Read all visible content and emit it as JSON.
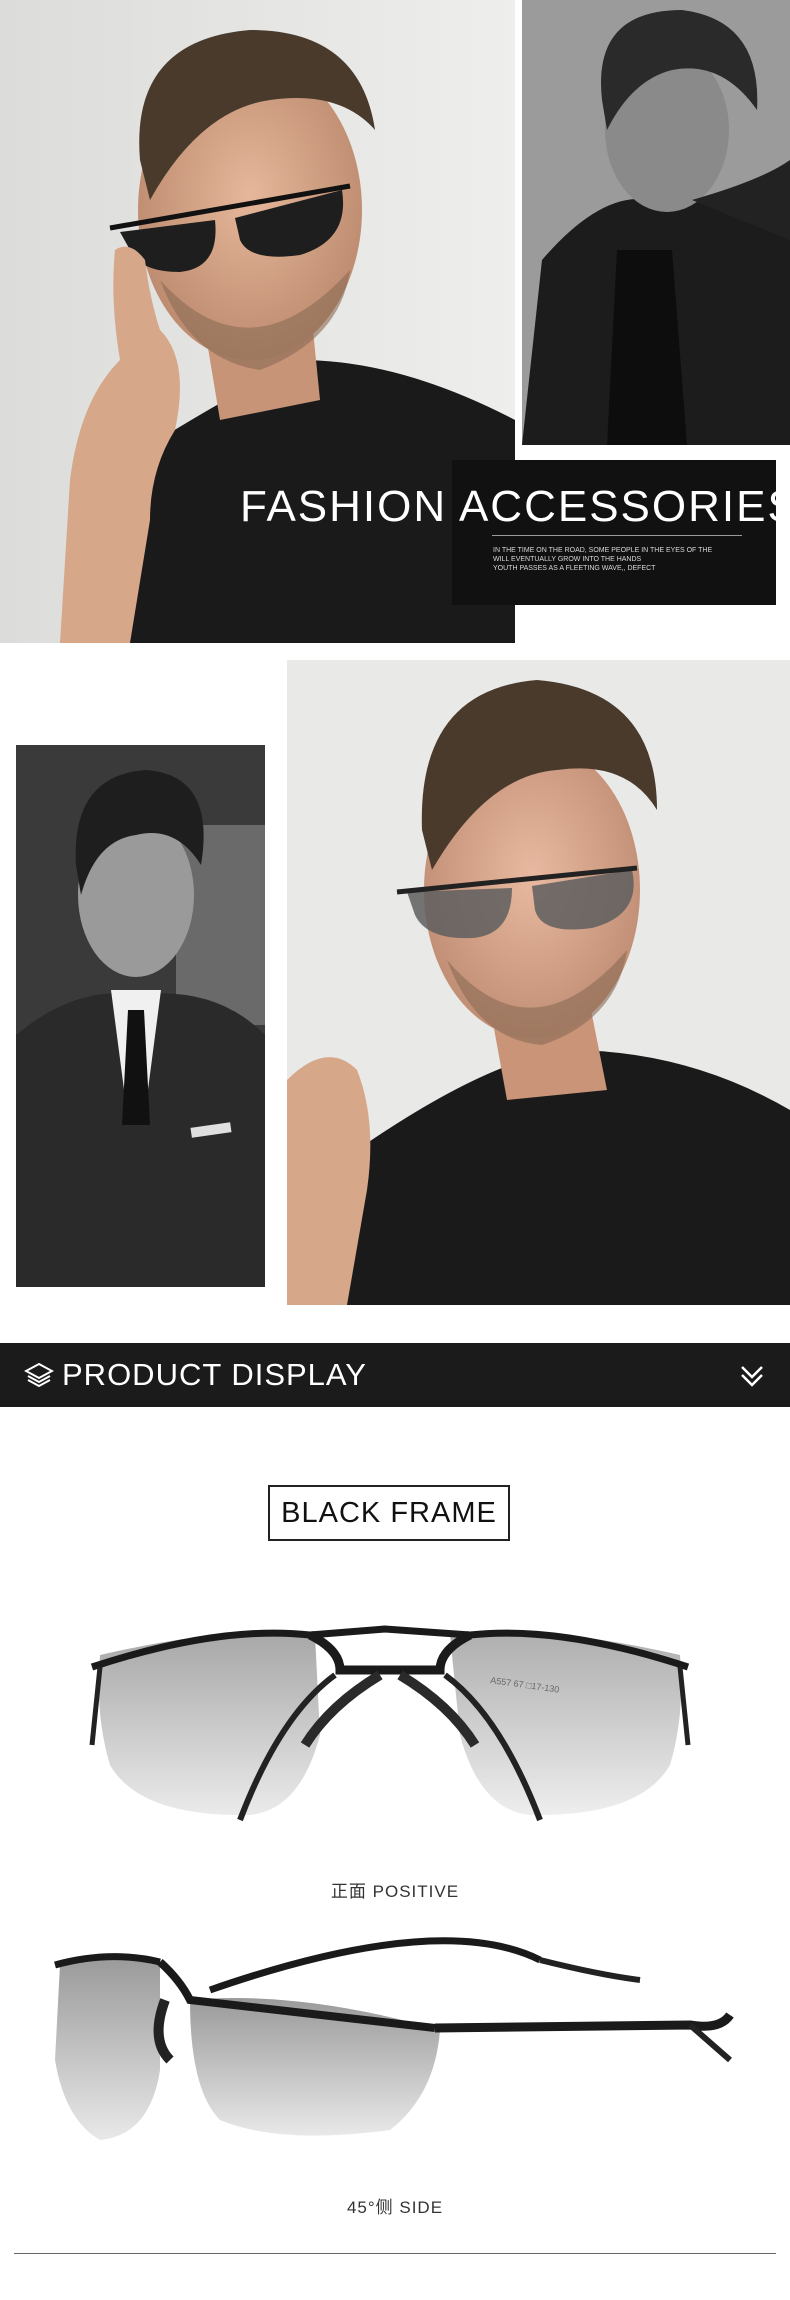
{
  "hero": {
    "title": "FASHION ACCESSORIES",
    "subtitle_lines": [
      "IN THE TIME ON THE ROAD, SOME PEOPLE IN THE EYES OF THE",
      "WILL EVENTUALLY GROW INTO THE HANDS",
      "YOUTH PASSES AS A FLEETING WAVE,, DEFECT"
    ]
  },
  "product_display": {
    "title": "PRODUCT DISPLAY",
    "icon_left": "layers-icon",
    "icon_right": "double-chevron-down-icon"
  },
  "frame": {
    "label": "BLACK FRAME",
    "front_caption": "正面 POSITIVE",
    "side_caption": "45°侧 SIDE",
    "temple_print": "A557 67 □17-130"
  },
  "colors": {
    "bar_bg": "#1b1b1b",
    "panel_bg": "#111111",
    "text_light": "#ffffff"
  }
}
